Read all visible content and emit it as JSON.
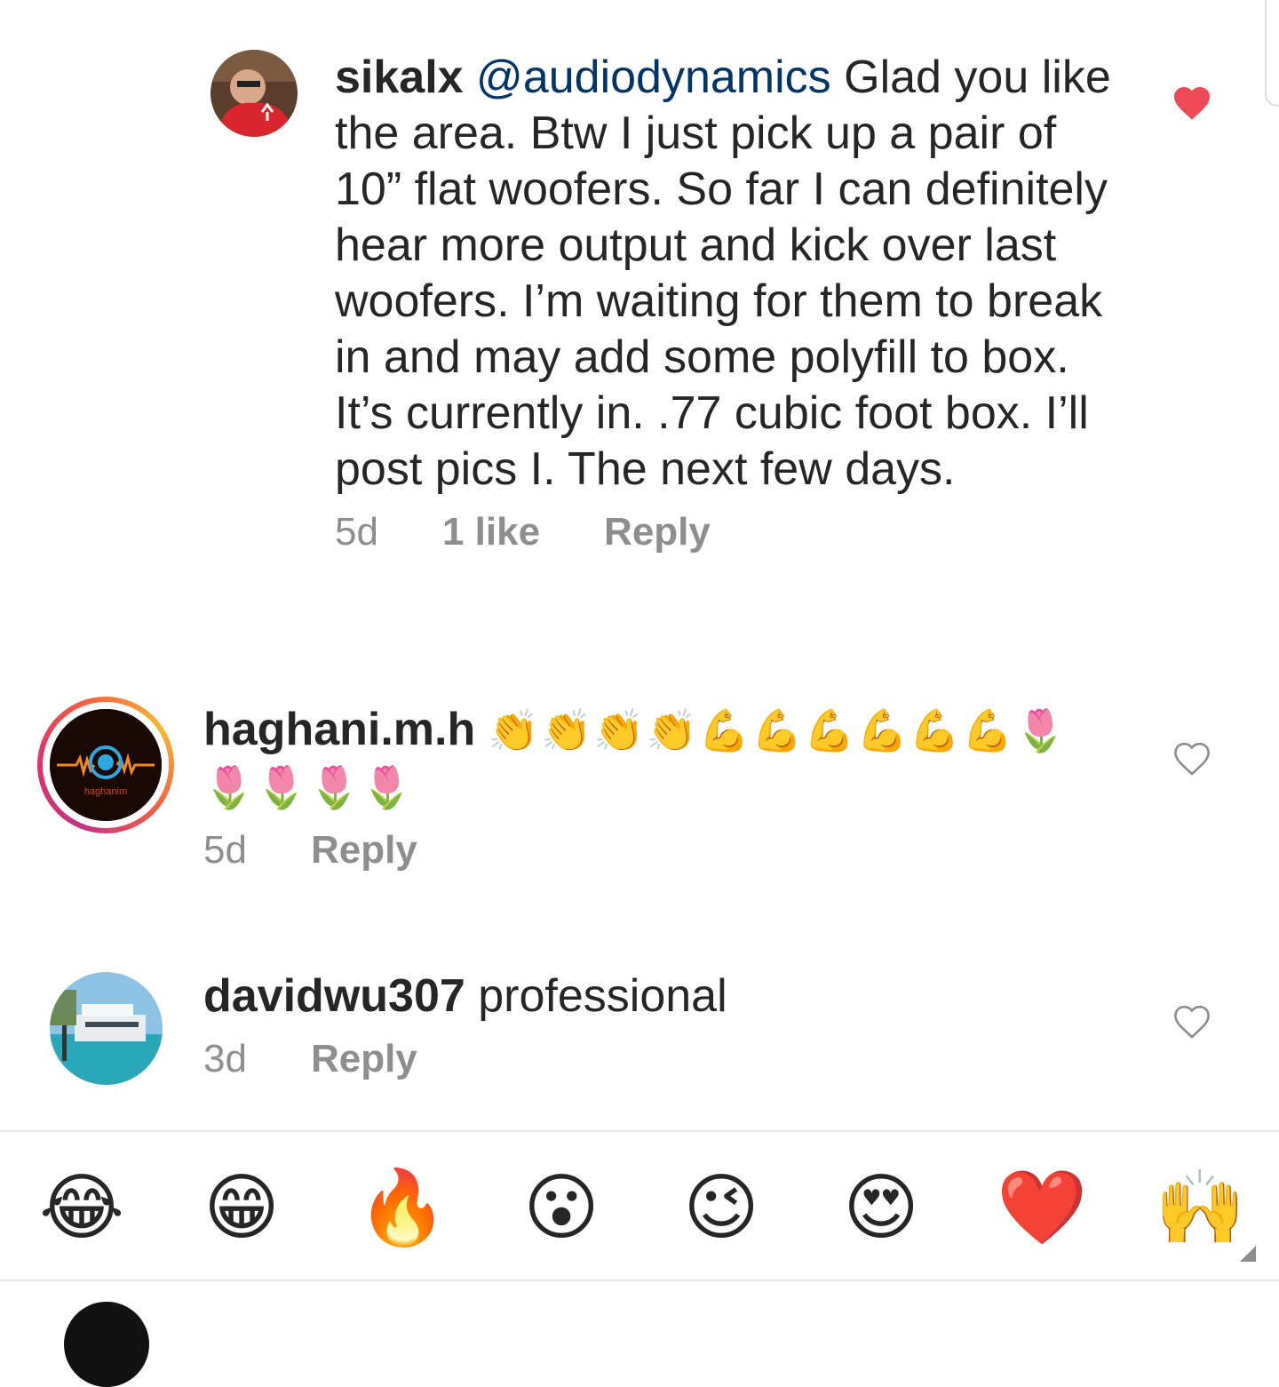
{
  "comments": [
    {
      "username": "sikalx",
      "mention": "@audiodynamics",
      "text": " Glad you like the area. Btw I just pick up a pair of 10” flat woofers. So far I can definitely hear more output and kick over last woofers. I’m waiting for them to break in and may add some polyfill to box. It’s currently in. .77 cubic foot box. I’ll post pics I. The next few days.",
      "time": "5d",
      "likes": "1 like",
      "reply": "Reply",
      "liked": true,
      "heart_icon": "heart-filled-icon"
    },
    {
      "username": "haghani.m.h",
      "emojis": "👏👏👏👏💪💪💪💪💪💪🌷",
      "emojis_line2": "🌷🌷🌷🌷",
      "avatar_label": "haghanim",
      "time": "5d",
      "reply": "Reply",
      "liked": false,
      "heart_icon": "heart-outline-icon"
    },
    {
      "username": "davidwu307",
      "text": " professional",
      "time": "3d",
      "reply": "Reply",
      "liked": false,
      "heart_icon": "heart-outline-icon"
    }
  ],
  "quick_emojis": [
    "😂",
    "😁",
    "🔥",
    "😮",
    "😉",
    "😍",
    "❤️",
    "🙌"
  ],
  "colors": {
    "heart_red": "#ed4956",
    "mention_blue": "#003569",
    "meta_gray": "#8e8e8e",
    "story_ring_start": "#c13584",
    "story_ring_end": "#f7b733"
  }
}
